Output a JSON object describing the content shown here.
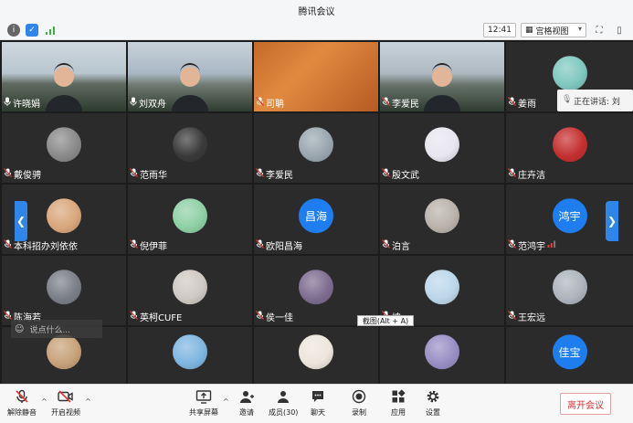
{
  "window": {
    "title": "腾讯会议"
  },
  "topbar": {
    "time": "12:41",
    "view_label": "宫格视图"
  },
  "speaking": {
    "label": "正在讲话: 刘"
  },
  "chat": {
    "placeholder": "说点什么..."
  },
  "tooltip": {
    "text": "截图(Alt + A)"
  },
  "participants": [
    {
      "name": "许晓娟",
      "video": true,
      "mic_active": true
    },
    {
      "name": "刘双舟",
      "video": true,
      "mic_active": true
    },
    {
      "name": "司聃",
      "video": true
    },
    {
      "name": "李爱民",
      "video": true
    },
    {
      "name": "姜雨",
      "avatar_color": "#7ec8c0"
    },
    {
      "name": "戴俊骋",
      "avatar_color": "#8a8a8a"
    },
    {
      "name": "范雨华",
      "avatar_color": "#3a3a3a"
    },
    {
      "name": "李爱民",
      "avatar_color": "#9aa7b0"
    },
    {
      "name": "殷文武",
      "avatar_color": "#e8e6ee"
    },
    {
      "name": "庄卉洁",
      "avatar_color": "#c43030"
    },
    {
      "name": "本科招办刘依依",
      "avatar_color": "#d9a77c"
    },
    {
      "name": "倪伊菲",
      "avatar_color": "#8fd0a6"
    },
    {
      "name": "欧阳昌海",
      "avatar_text": "昌海"
    },
    {
      "name": "泊言",
      "avatar_color": "#b9b3ab"
    },
    {
      "name": "范鸿宇",
      "avatar_text": "鸿宇"
    },
    {
      "name": "陈海若",
      "avatar_color": "#7b7f86"
    },
    {
      "name": "英柯CUFE",
      "avatar_color": "#cfc9c3"
    },
    {
      "name": "侯一佳",
      "avatar_color": "#7d6d90"
    },
    {
      "name": "坤",
      "avatar_color": "#bcd7ea"
    },
    {
      "name": "王宏远",
      "avatar_color": "#aeb4bd"
    },
    {
      "name": "",
      "avatar_color": "#c7a27a"
    },
    {
      "name": "",
      "avatar_color": "#7fb6e0"
    },
    {
      "name": "",
      "avatar_color": "#ece6dc"
    },
    {
      "name": "",
      "avatar_color": "#9a8fc4"
    },
    {
      "name": "",
      "avatar_text": "佳宝"
    }
  ],
  "bottombar": {
    "unmute": "解除静音",
    "start_video": "开启视频",
    "share_screen": "共享屏幕",
    "invite": "邀请",
    "members": "成员(30)",
    "chat": "聊天",
    "record": "录制",
    "apps": "应用",
    "settings": "设置",
    "leave": "离开会议"
  }
}
